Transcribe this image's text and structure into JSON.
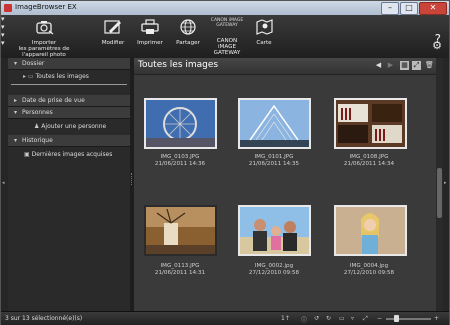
{
  "window": {
    "title": "ImageBrowser EX"
  },
  "toolbar": {
    "import": "Importer\nles paramètres de l'appareil photo",
    "edit": "Modifier",
    "print": "Imprimer",
    "share": "Partager",
    "gateway_logo": "CANON iMAGE GATEWAY",
    "gateway": "CANON iMAGE\nGATEWAY",
    "map": "Carte",
    "help": "?"
  },
  "sidebar": {
    "folder": "Dossier",
    "all_images": "Toutes les images",
    "date": "Date de prise de vue",
    "people": "Personnes",
    "add_person": "Ajouter une personne",
    "history": "Historique",
    "last_acquired": "Dernières images acquises"
  },
  "main": {
    "title": "Toutes les images"
  },
  "images": [
    {
      "name": "IMG_0103.JPG",
      "date": "21/06/2011 14:36"
    },
    {
      "name": "IMG_0101.JPG",
      "date": "21/06/2011 14:35"
    },
    {
      "name": "IMG_0108.JPG",
      "date": "21/06/2011 14:34"
    },
    {
      "name": "IMG_0113.JPG",
      "date": "21/06/2011 14:31"
    },
    {
      "name": "IMG_0002.jpg",
      "date": "27/12/2010 09:58"
    },
    {
      "name": "IMG_0004.jpg",
      "date": "27/12/2010 09:58"
    }
  ],
  "status": {
    "selection": "3 sur 13 sélectionné(e)(s)",
    "list_mode": "1↑"
  },
  "zoom_level": 0.2
}
